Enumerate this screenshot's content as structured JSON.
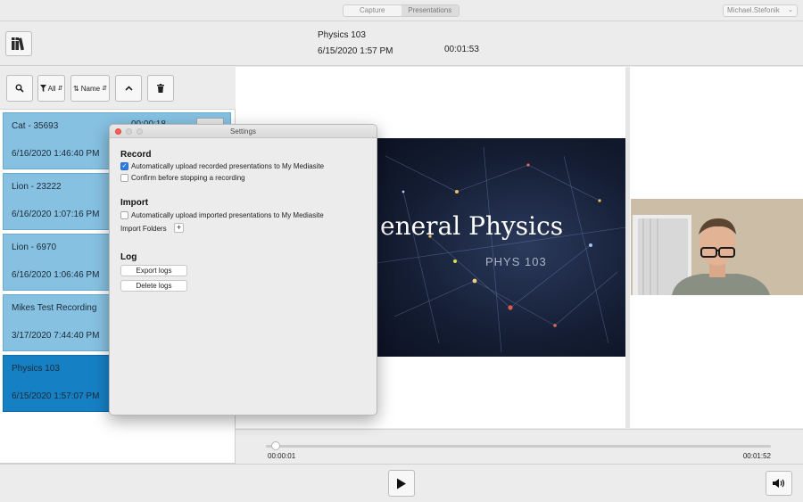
{
  "topbar": {
    "tabs": [
      {
        "label": "Capture",
        "active": false
      },
      {
        "label": "Presentations",
        "active": true
      }
    ],
    "user": "Michael.Stefonik"
  },
  "header": {
    "title": "Physics 103",
    "date": "6/15/2020 1:57 PM",
    "duration": "00:01:53"
  },
  "toolbar": {
    "filter_label": "All",
    "sort_label": "Name"
  },
  "recordings": [
    {
      "name": "Cat - 35693",
      "date": "6/16/2020 1:46:40 PM",
      "duration": "00:00:18",
      "selected": false
    },
    {
      "name": "Lion - 23222",
      "date": "6/16/2020 1:07:16 PM",
      "duration": "",
      "selected": false
    },
    {
      "name": "Lion - 6970",
      "date": "6/16/2020 1:06:46 PM",
      "duration": "",
      "selected": false
    },
    {
      "name": "Mikes Test Recording",
      "date": "3/17/2020 7:44:40 PM",
      "duration": "",
      "selected": false
    },
    {
      "name": "Physics 103",
      "date": "6/15/2020 1:57:07 PM",
      "duration": "",
      "selected": true
    }
  ],
  "slide": {
    "title": "eneral Physics",
    "subtitle": "PHYS 103"
  },
  "player": {
    "current_time": "00:00:01",
    "total_time": "00:01:52",
    "progress": 0.02
  },
  "settings": {
    "title": "Settings",
    "record_heading": "Record",
    "record_opt1": "Automatically upload recorded presentations to My Mediasite",
    "record_opt1_checked": true,
    "record_opt2": "Confirm before stopping a recording",
    "record_opt2_checked": false,
    "import_heading": "Import",
    "import_opt1": "Automatically upload imported presentations to My Mediasite",
    "import_opt1_checked": false,
    "import_folders_label": "Import Folders",
    "import_folders_add": "+",
    "log_heading": "Log",
    "export_logs": "Export logs",
    "delete_logs": "Delete logs"
  },
  "colors": {
    "item_bg": "#86c1e2",
    "item_selected_bg": "#1680c4",
    "checkbox_on": "#2f7be0"
  }
}
